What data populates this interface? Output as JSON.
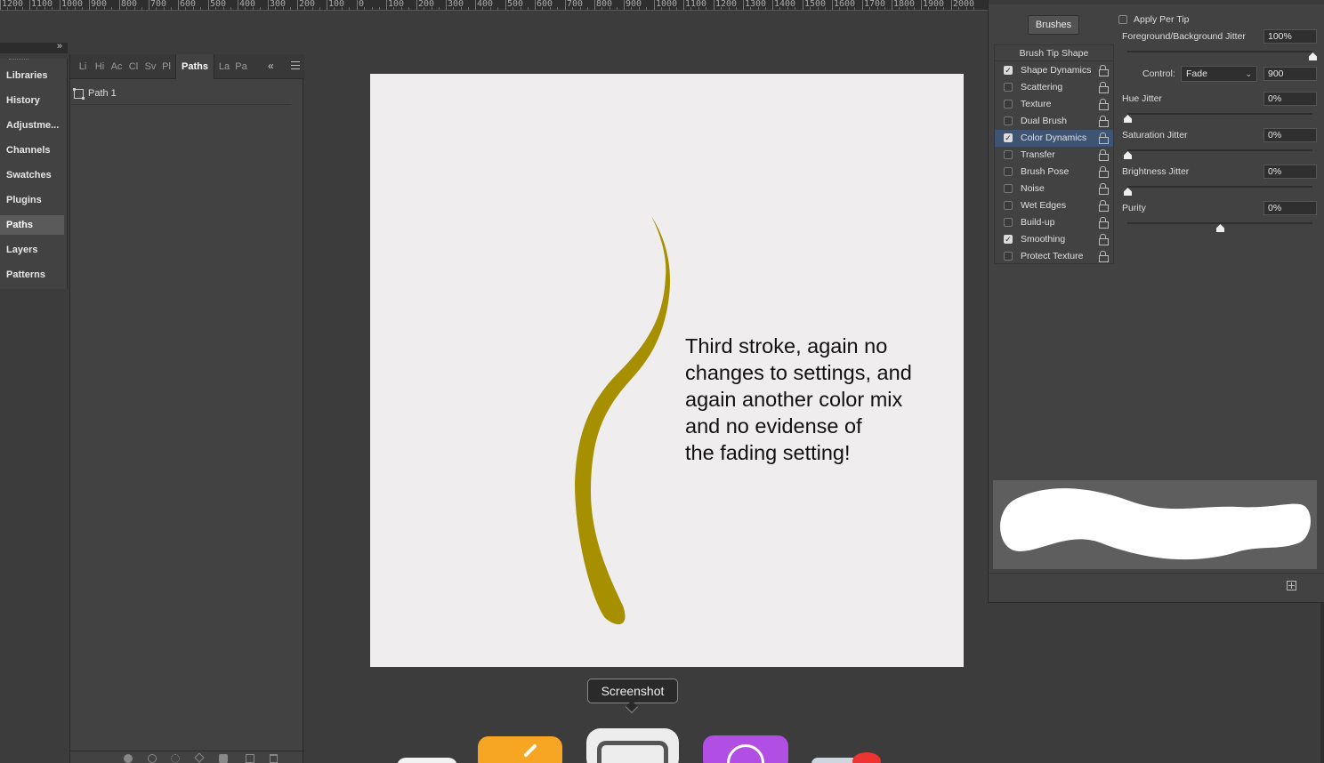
{
  "ruler": {
    "labels": [
      "1200",
      "1100",
      "1000",
      "900",
      "800",
      "700",
      "600",
      "500",
      "400",
      "300",
      "200",
      "100",
      "0",
      "100",
      "200",
      "300",
      "400",
      "500",
      "600",
      "700",
      "800",
      "900",
      "1000",
      "1100",
      "1200",
      "1300",
      "1400",
      "1500",
      "1600",
      "1700",
      "1800",
      "1900",
      "2000"
    ]
  },
  "left_dock": {
    "items": [
      {
        "label": "Libraries"
      },
      {
        "label": "History"
      },
      {
        "label": "Adjustme..."
      },
      {
        "label": "Channels"
      },
      {
        "label": "Swatches"
      },
      {
        "label": "Plugins"
      },
      {
        "label": "Paths",
        "active": true
      },
      {
        "label": "Layers"
      },
      {
        "label": "Patterns"
      }
    ]
  },
  "paths_panel": {
    "tabs": [
      "Li",
      "Hi",
      "Aс",
      "Cl",
      "Sv",
      "Pl",
      "Paths",
      "La",
      "Pa"
    ],
    "active_tab": "Paths",
    "collapse_glyph": "«",
    "path_name": "Path 1"
  },
  "document": {
    "text": "Third stroke, again no\nchanges to settings, and\nagain another color mix\nand no evidense of\nthe fading setting!",
    "stroke_color": "#a69000",
    "background_color": "#efedee"
  },
  "tooltip": {
    "label": "Screenshot"
  },
  "brush_settings": {
    "brushes_button": "Brushes",
    "brush_tip_shape": "Brush Tip Shape",
    "options": [
      {
        "label": "Shape Dynamics",
        "checked": true
      },
      {
        "label": "Scattering",
        "checked": false
      },
      {
        "label": "Texture",
        "checked": false
      },
      {
        "label": "Dual Brush",
        "checked": false
      },
      {
        "label": "Color Dynamics",
        "checked": true,
        "active": true
      },
      {
        "label": "Transfer",
        "checked": false
      },
      {
        "label": "Brush Pose",
        "checked": false
      },
      {
        "label": "Noise",
        "checked": false
      },
      {
        "label": "Wet Edges",
        "checked": false
      },
      {
        "label": "Build-up",
        "checked": false
      },
      {
        "label": "Smoothing",
        "checked": true
      },
      {
        "label": "Protect Texture",
        "checked": false
      }
    ],
    "apply_per_tip": "Apply Per Tip",
    "fg_bg_jitter": {
      "label": "Foreground/Background Jitter",
      "value": "100%",
      "level": 1.0
    },
    "control": {
      "label": "Control:",
      "value": "Fade",
      "fade_steps": "900"
    },
    "hue_jitter": {
      "label": "Hue Jitter",
      "value": "0%",
      "level": 0.0
    },
    "saturation_jitter": {
      "label": "Saturation Jitter",
      "value": "0%",
      "level": 0.0
    },
    "brightness_jitter": {
      "label": "Brightness Jitter",
      "value": "0%",
      "level": 0.0
    },
    "purity": {
      "label": "Purity",
      "value": "0%",
      "level": 0.5
    }
  },
  "colors": {
    "active_option": "#3f5373",
    "panel_bg": "#424242",
    "app_bg": "#3c3c3c"
  }
}
